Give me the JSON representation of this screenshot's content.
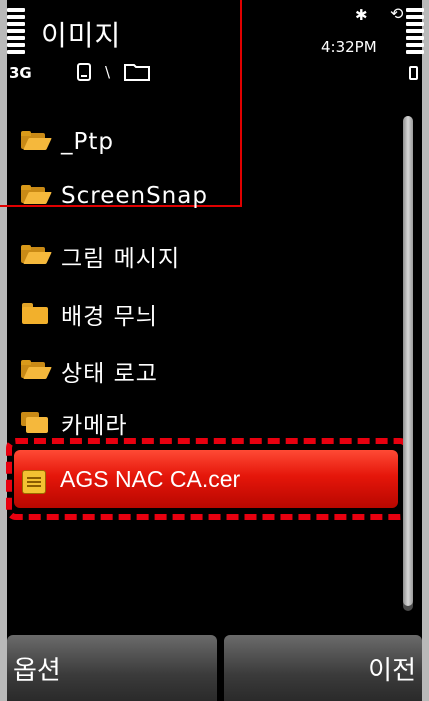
{
  "status_bar": {
    "title": "이미지",
    "network": "3G",
    "clock": "4:32PM",
    "path_separator": "\\"
  },
  "folders": [
    {
      "label": "_Ptp",
      "icon": "open-folder-icon"
    },
    {
      "label": "ScreenSnap",
      "icon": "open-folder-icon"
    },
    {
      "label": "그림 메시지",
      "icon": "open-folder-icon"
    },
    {
      "label": "배경 무늬",
      "icon": "closed-folder-icon"
    },
    {
      "label": "상태 로고",
      "icon": "open-folder-icon"
    },
    {
      "label": "카메라",
      "icon": "multi-folder-icon"
    }
  ],
  "selected_file": {
    "label": "AGS NAC CA.cer",
    "icon": "certificate-file-icon"
  },
  "softkeys": {
    "left": "옵션",
    "right": "이전"
  },
  "colors": {
    "selection": "#e5160a",
    "annotation": "#e8000f",
    "folder": "#f5b83c"
  }
}
